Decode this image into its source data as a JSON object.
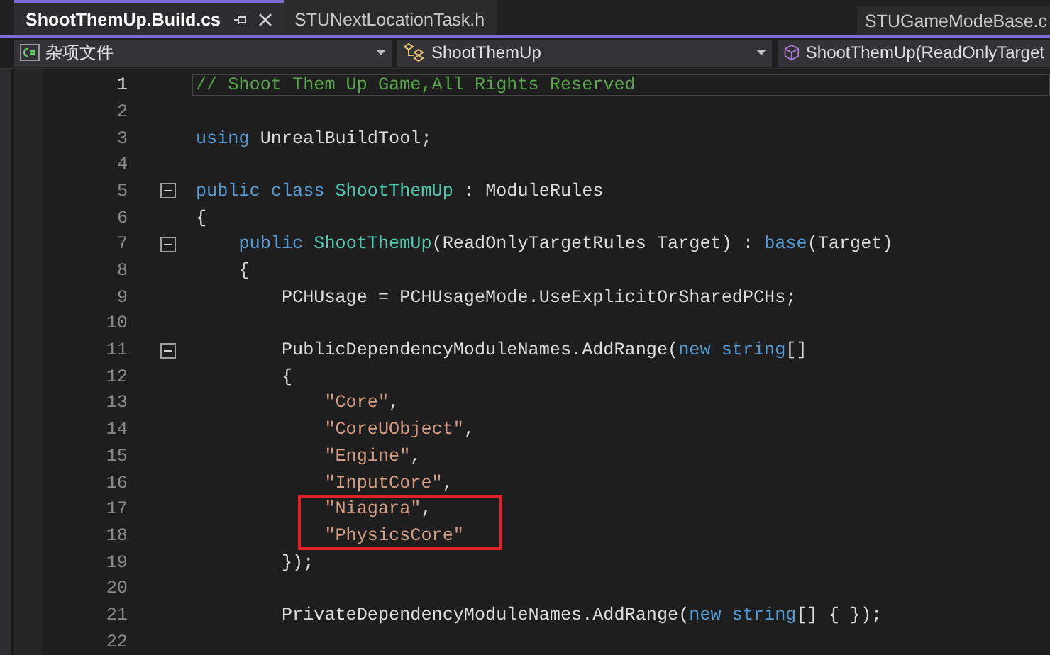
{
  "tabs": [
    {
      "label": "ShootThemUp.Build.cs",
      "selected": true,
      "pinnable": true,
      "closable": true
    },
    {
      "label": "STUNextLocationTask.h",
      "selected": false,
      "pinnable": false,
      "closable": false
    }
  ],
  "side_tabs": [
    {
      "label": "STUGameModeBase.c",
      "selected": false
    }
  ],
  "navigation_bar": [
    {
      "kind": "project",
      "label": "杂项文件"
    },
    {
      "kind": "class",
      "label": "ShootThemUp"
    },
    {
      "kind": "member",
      "label": "ShootThemUp(ReadOnlyTarget"
    }
  ],
  "lines": [
    {
      "kind": "line",
      "number": "1",
      "current": true,
      "tokens": [
        {
          "kind": "comment",
          "text": "// Shoot Them Up Game,All Rights Reserved"
        }
      ]
    },
    {
      "kind": "line",
      "number": "2",
      "current": false
    },
    {
      "kind": "line",
      "number": "3",
      "current": false,
      "tokens": [
        {
          "kind": "keyword",
          "text": "using"
        },
        {
          "kind": "plain",
          "text": " UnrealBuildTool;"
        }
      ]
    },
    {
      "kind": "line",
      "number": "4",
      "current": false
    },
    {
      "kind": "line",
      "number": "5",
      "current": false,
      "expanded": true,
      "tokens": [
        {
          "kind": "keyword",
          "text": "public class "
        },
        {
          "kind": "type",
          "text": "ShootThemUp"
        },
        {
          "kind": "plain",
          "text": " : ModuleRules"
        }
      ]
    },
    {
      "kind": "line",
      "number": "6",
      "current": false,
      "tokens": [
        {
          "kind": "plain",
          "text": "{"
        }
      ]
    },
    {
      "kind": "line",
      "number": "7",
      "current": false,
      "expanded": true,
      "tokens": [
        {
          "kind": "keyword",
          "text": "    public "
        },
        {
          "kind": "type",
          "text": "ShootThemUp"
        },
        {
          "kind": "plain",
          "text": "(ReadOnlyTargetRules Target) : "
        },
        {
          "kind": "keyword",
          "text": "base"
        },
        {
          "kind": "plain",
          "text": "(Target)"
        }
      ]
    },
    {
      "kind": "line",
      "number": "8",
      "current": false,
      "tokens": [
        {
          "kind": "plain",
          "text": "    {"
        }
      ]
    },
    {
      "kind": "line",
      "number": "9",
      "current": false,
      "tokens": [
        {
          "kind": "plain",
          "text": "        PCHUsage = PCHUsageMode.UseExplicitOrSharedPCHs;"
        }
      ]
    },
    {
      "kind": "line",
      "number": "10",
      "current": false
    },
    {
      "kind": "line",
      "number": "11",
      "current": false,
      "expanded": true,
      "tokens": [
        {
          "kind": "plain",
          "text": "        PublicDependencyModuleNames.AddRange("
        },
        {
          "kind": "keyword",
          "text": "new string"
        },
        {
          "kind": "plain",
          "text": "[]"
        }
      ]
    },
    {
      "kind": "line",
      "number": "12",
      "current": false,
      "tokens": [
        {
          "kind": "plain",
          "text": "        {"
        }
      ]
    },
    {
      "kind": "line",
      "number": "13",
      "current": false,
      "tokens": [
        {
          "kind": "string",
          "text": "            \"Core\""
        },
        {
          "kind": "plain",
          "text": ","
        }
      ]
    },
    {
      "kind": "line",
      "number": "14",
      "current": false,
      "tokens": [
        {
          "kind": "string",
          "text": "            \"CoreUObject\""
        },
        {
          "kind": "plain",
          "text": ","
        }
      ]
    },
    {
      "kind": "line",
      "number": "15",
      "current": false,
      "tokens": [
        {
          "kind": "string",
          "text": "            \"Engine\""
        },
        {
          "kind": "plain",
          "text": ","
        }
      ]
    },
    {
      "kind": "line",
      "number": "16",
      "current": false,
      "tokens": [
        {
          "kind": "string",
          "text": "            \"InputCore\""
        },
        {
          "kind": "plain",
          "text": ","
        }
      ]
    },
    {
      "kind": "highlight",
      "lines": [
        {
          "kind": "line",
          "number": "17",
          "current": false,
          "tokens": [
            {
              "kind": "string",
              "text": "            \"Niagara\""
            },
            {
              "kind": "plain",
              "text": ","
            }
          ]
        },
        {
          "kind": "line",
          "number": "18",
          "current": false,
          "tokens": [
            {
              "kind": "string",
              "text": "            \"PhysicsCore\""
            }
          ]
        }
      ]
    },
    {
      "kind": "line",
      "number": "19",
      "current": false,
      "tokens": [
        {
          "kind": "plain",
          "text": "        });"
        }
      ]
    },
    {
      "kind": "line",
      "number": "20",
      "current": false
    },
    {
      "kind": "line",
      "number": "21",
      "current": false,
      "tokens": [
        {
          "kind": "plain",
          "text": "        PrivateDependencyModuleNames.AddRange("
        },
        {
          "kind": "keyword",
          "text": "new string"
        },
        {
          "kind": "plain",
          "text": "[] { });"
        }
      ]
    },
    {
      "kind": "line",
      "number": "22",
      "current": false
    }
  ]
}
